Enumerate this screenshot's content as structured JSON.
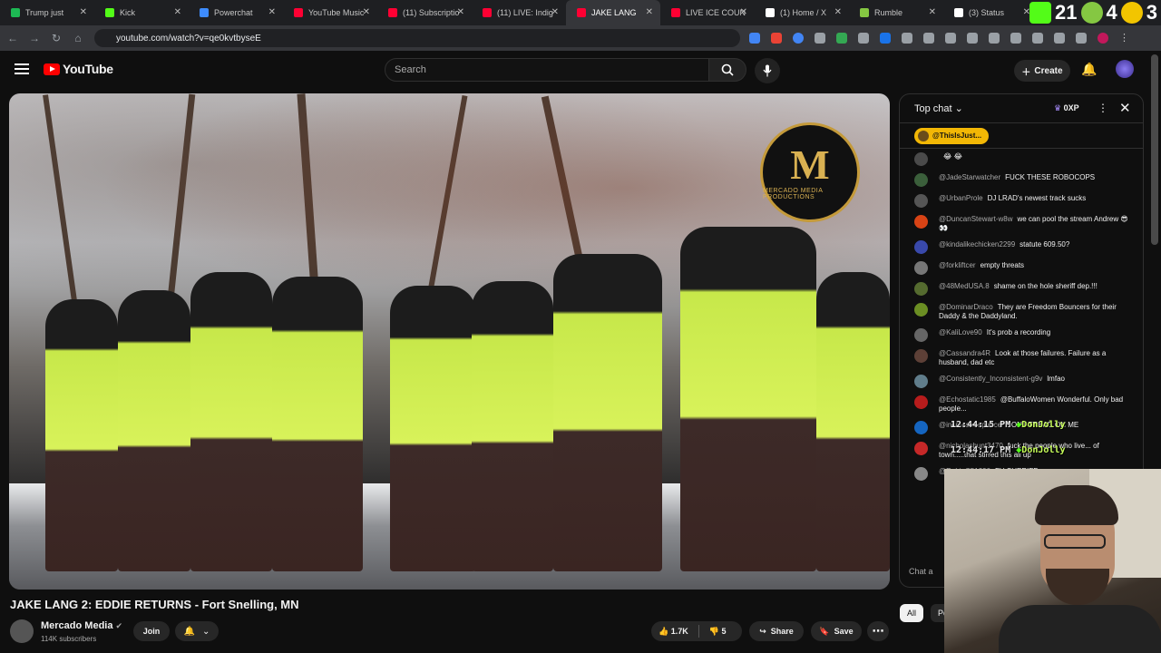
{
  "browser": {
    "tabs": [
      {
        "label": "Trump just",
        "color": "#1db954"
      },
      {
        "label": "Kick",
        "color": "#53fc18"
      },
      {
        "label": "Powerchat",
        "color": "#3d8bfd"
      },
      {
        "label": "YouTube Music",
        "color": "#ff0033"
      },
      {
        "label": "(11) Subscriptio",
        "color": "#ff0033"
      },
      {
        "label": "(11) LIVE: Indig",
        "color": "#ff0033"
      },
      {
        "label": "JAKE LANG",
        "color": "#ff0033"
      },
      {
        "label": "LIVE ICE COUN",
        "color": "#ff0033"
      },
      {
        "label": "(1) Home / X",
        "color": "#ffffff"
      },
      {
        "label": "Rumble",
        "color": "#85c742"
      },
      {
        "label": "(3) Status",
        "color": "#ffffff"
      }
    ],
    "active_tab_index": 6,
    "counters": {
      "kick": "21",
      "rumble": "4",
      "other": "3"
    },
    "url": "youtube.com/watch?v=qe0kvtbyseE"
  },
  "youtube": {
    "logo_text": "YouTube",
    "search_placeholder": "Search",
    "create_label": "Create"
  },
  "video": {
    "watermark_letter": "M",
    "watermark_text": "MERCADO MEDIA PRODUCTIONS",
    "title": "JAKE LANG 2: EDDIE RETURNS - Fort Snelling, MN",
    "channel": "Mercado Media",
    "subscribers": "114K subscribers",
    "join_label": "Join",
    "likes": "1.7K",
    "dislikes": "5",
    "share_label": "Share",
    "save_label": "Save"
  },
  "chat": {
    "mode": "Top chat",
    "xp": "0XP",
    "pinned_user": "@ThisIsJust...",
    "input_placeholder": "Chat a",
    "messages": [
      {
        "user": "",
        "text": "😂 😂",
        "color": "#4a4a4a"
      },
      {
        "user": "@JadeStarwatcher",
        "text": "FUCK THESE ROBOCOPS",
        "color": "#3b5f3b"
      },
      {
        "user": "@UrbanProle",
        "text": "DJ LRAD's newest track sucks",
        "color": "#555"
      },
      {
        "user": "@DuncanStewart-w8w",
        "text": "we can pool the stream Andrew 😎 👀",
        "color": "#d84315"
      },
      {
        "user": "@kindalikechicken2299",
        "text": "statute 609.50?",
        "color": "#3949ab"
      },
      {
        "user": "@forkliftcer",
        "text": "empty threats",
        "color": "#777"
      },
      {
        "user": "@48MedUSA.8",
        "text": "shame on the hole sheriff dep.!!!",
        "color": "#556b2f"
      },
      {
        "user": "@DominarDraco",
        "text": "They are Freedom Bouncers for their Daddy & the Daddyland.",
        "color": "#6b8e23"
      },
      {
        "user": "@KaliLove90",
        "text": "It's prob a recording",
        "color": "#666"
      },
      {
        "user": "@Cassandra4R",
        "text": "Look at those failures. Failure as a husband, dad etc",
        "color": "#5d4037"
      },
      {
        "user": "@Consistently_Inconsistent-g9v",
        "text": "lmfao",
        "color": "#607d8b"
      },
      {
        "user": "@Echostatic1985",
        "text": "@BuffaloWomen Wonderful. Only bad people...",
        "color": "#b71c1c"
      },
      {
        "user": "@increasedapeace",
        "text": "DONT TREAD ON ME",
        "color": "#1565c0"
      },
      {
        "user": "@nicholashunt3470",
        "text": "fuck the people who live... of town.....that stirred this all up",
        "color": "#c62828"
      },
      {
        "user": "@RobinC51290",
        "text": "FU SHERIFF",
        "color": "#888"
      }
    ],
    "overlay": [
      {
        "time": "12:44:15 PM",
        "user": "DonJolly"
      },
      {
        "time": "12:44:17 PM",
        "user": "DonJolly"
      }
    ],
    "filter_chips": [
      "All",
      "Po"
    ]
  }
}
